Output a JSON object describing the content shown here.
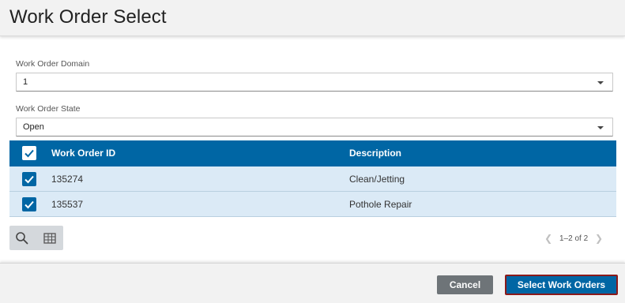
{
  "header": {
    "title": "Work Order Select"
  },
  "form": {
    "domain": {
      "label": "Work Order Domain",
      "value": "1"
    },
    "state": {
      "label": "Work Order State",
      "value": "Open"
    }
  },
  "table": {
    "columns": {
      "id": "Work Order ID",
      "description": "Description"
    },
    "select_all_checked": true,
    "rows": [
      {
        "id": "135274",
        "description": "Clean/Jetting",
        "checked": true
      },
      {
        "id": "135537",
        "description": "Pothole Repair",
        "checked": true
      }
    ]
  },
  "toolbar": {
    "icons": [
      "search-icon",
      "table-icon"
    ]
  },
  "pager": {
    "text": "1–2 of 2",
    "prev_icon": "chevron-left-icon",
    "next_icon": "chevron-right-icon"
  },
  "footer": {
    "cancel_label": "Cancel",
    "select_label": "Select Work Orders"
  },
  "colors": {
    "primary": "#0066a4",
    "row_selected": "#dbeaf6",
    "cancel": "#6e7478",
    "focus_outline": "#8b1a1a"
  }
}
